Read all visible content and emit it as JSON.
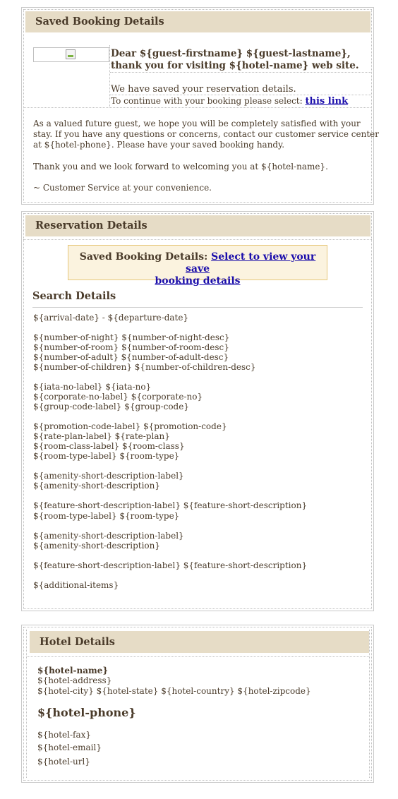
{
  "saved_booking": {
    "header": "Saved Booking Details",
    "greeting_line1": "Dear ${guest-firstname} ${guest-lastname},",
    "greeting_line2": "thank you for visiting ${hotel-name} web site.",
    "saved_msg": "We have saved your reservation details.",
    "continue_prefix": "To continue with your booking please select:",
    "continue_link": "this link",
    "body_line1": "As a valued future guest, we hope you will be completely satisfied with your",
    "body_line2": "stay. If you have any questions or concerns, contact our customer service center",
    "body_line3": "at ${hotel-phone}. Please have your saved booking handy.",
    "thanks": "Thank you and we look forward to welcoming you at ${hotel-name}.",
    "signature": "~ Customer Service at your convenience."
  },
  "reservation": {
    "header": "Reservation Details",
    "promo_label": "Saved Booking Details:",
    "promo_link_line1": "Select to view your save",
    "promo_link_line2": "booking details",
    "search_title": "Search Details",
    "lines": [
      "${arrival-date} - ${departure-date}",
      "${number-of-night} ${number-of-night-desc}",
      "${number-of-room} ${number-of-room-desc}",
      "${number-of-adult} ${number-of-adult-desc}",
      "${number-of-children} ${number-of-children-desc}",
      "${iata-no-label} ${iata-no}",
      "${corporate-no-label} ${corporate-no}",
      "${group-code-label} ${group-code}",
      "${promotion-code-label} ${promotion-code}",
      "${rate-plan-label} ${rate-plan}",
      "${room-class-label} ${room-class}",
      "${room-type-label} ${room-type}",
      "${amenity-short-description-label}",
      "${amenity-short-description}",
      "${feature-short-description-label} ${feature-short-description}",
      "${room-type-label} ${room-type}",
      "${amenity-short-description-label}",
      "${amenity-short-description}",
      "${feature-short-description-label} ${feature-short-description}",
      "${additional-items}"
    ]
  },
  "hotel": {
    "header": "Hotel Details",
    "name": "${hotel-name}",
    "address": "${hotel-address}",
    "city_line": "${hotel-city} ${hotel-state} ${hotel-country} ${hotel-zipcode}",
    "phone": "${hotel-phone}",
    "fax": "${hotel-fax}",
    "email": "${hotel-email}",
    "url": "${hotel-url}"
  }
}
